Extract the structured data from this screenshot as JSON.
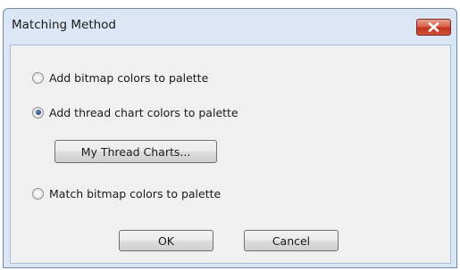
{
  "dialog": {
    "title": "Matching Method"
  },
  "options": [
    {
      "label": "Add bitmap colors to palette",
      "checked": false
    },
    {
      "label": "Add thread chart colors to palette",
      "checked": true
    },
    {
      "label": "Match bitmap colors to palette",
      "checked": false
    }
  ],
  "buttons": {
    "thread_charts": "My Thread Charts...",
    "ok": "OK",
    "cancel": "Cancel"
  },
  "colors": {
    "frame": "#dbe6f4",
    "client": "#f0f0f0",
    "close_red": "#c2331c",
    "focus_blue": "#3c7fb1"
  },
  "icons": {
    "close": "close-icon",
    "radio_checked": "radio-checked-icon",
    "radio_unchecked": "radio-unchecked-icon"
  }
}
